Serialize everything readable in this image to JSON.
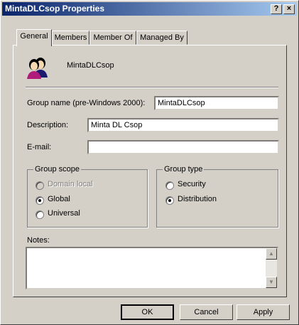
{
  "window": {
    "title": "MintaDLCsop Properties",
    "help_button": "?",
    "close_button": "×"
  },
  "tabs": [
    {
      "label": "General",
      "active": true
    },
    {
      "label": "Members",
      "active": false
    },
    {
      "label": "Member Of",
      "active": false
    },
    {
      "label": "Managed By",
      "active": false
    }
  ],
  "general": {
    "group_icon": "group-users-icon",
    "group_display_name": "MintaDLCsop",
    "pre_windows_label": "Group name (pre-Windows 2000):",
    "pre_windows_value": "MintaDLCsop",
    "description_label": "Description:",
    "description_value": "Minta DL Csop",
    "email_label": "E-mail:",
    "email_value": "",
    "group_scope": {
      "title": "Group scope",
      "options": [
        {
          "label": "Domain local",
          "selected": false,
          "enabled": false
        },
        {
          "label": "Global",
          "selected": true,
          "enabled": true
        },
        {
          "label": "Universal",
          "selected": false,
          "enabled": true
        }
      ]
    },
    "group_type": {
      "title": "Group type",
      "options": [
        {
          "label": "Security",
          "selected": false,
          "enabled": true
        },
        {
          "label": "Distribution",
          "selected": true,
          "enabled": true
        }
      ]
    },
    "notes_label": "Notes:",
    "notes_value": ""
  },
  "buttons": {
    "ok": "OK",
    "cancel": "Cancel",
    "apply": "Apply"
  }
}
